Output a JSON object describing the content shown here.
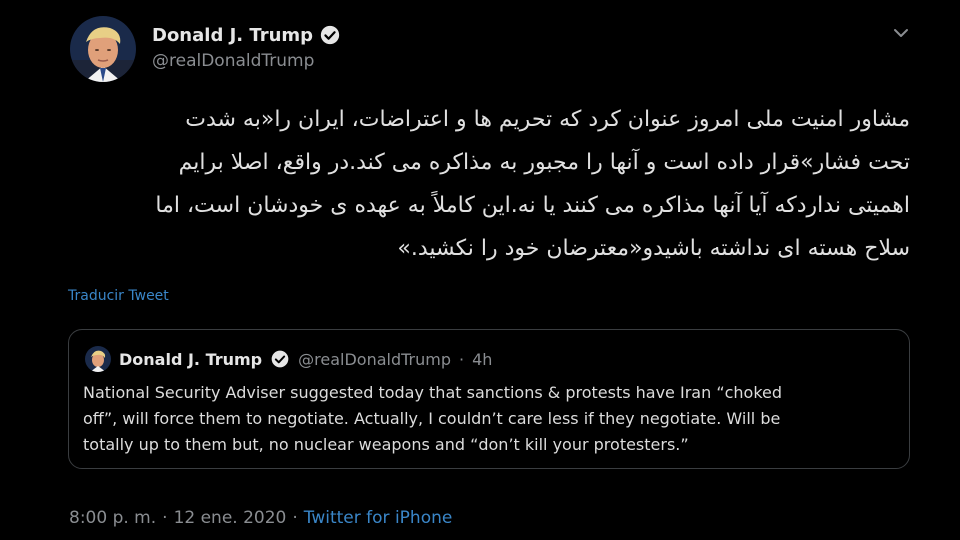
{
  "author": {
    "name": "Donald J. Trump",
    "handle": "@realDonaldTrump",
    "verified_icon": "verified-badge"
  },
  "tweet": {
    "lines": [
      "مشاور امنیت ملی امروز عنوان کرد که تحریم ها و اعتراضات، ایران را«به شدت",
      "تحت فشار»قرار داده است و آنها را مجبور به مذاکره می کند.در واقع، اصلا برایم",
      "اهمیتی نداردکه آیا آنها مذاکره می کنند یا نه.این کاملاً به عهده ی خودشان است، اما",
      "سلاح هسته ای نداشته باشیدو«معترضان خود را نکشید.»"
    ],
    "translate_label": "Traducir Tweet"
  },
  "quoted": {
    "name": "Donald J. Trump",
    "handle": "@realDonaldTrump",
    "separator": "·",
    "age": "4h",
    "lines": [
      "National Security Adviser suggested today that sanctions & protests have Iran “choked",
      "off”, will force them to negotiate. Actually, I couldn’t care less if they negotiate. Will be",
      "totally up to them but, no nuclear weapons and “don’t kill your protesters.”"
    ]
  },
  "meta": {
    "time": "8:00 p. m.",
    "sep1": "·",
    "date": "12 ene. 2020",
    "sep2": "·",
    "source": "Twitter for iPhone"
  },
  "colors": {
    "background": "#000000",
    "link": "#3a86c8",
    "secondary_text": "#8a8d91",
    "border": "#3a3d40"
  }
}
